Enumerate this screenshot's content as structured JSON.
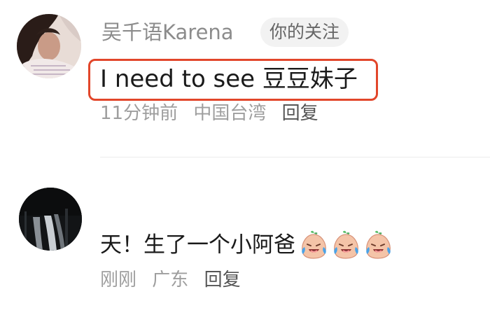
{
  "comments": [
    {
      "username": "吴千语Karena",
      "badge": "你的关注",
      "text": "I need to see 豆豆妹子",
      "time": "11分钟前",
      "location": "中国台湾",
      "reply_label": "回复",
      "highlight_color": "#e2462a"
    },
    {
      "text": "天！生了一个小阿爸",
      "emojis": [
        "crying-laugh-emoji",
        "crying-laugh-emoji",
        "crying-laugh-emoji"
      ],
      "time": "刚刚",
      "location": "广东",
      "reply_label": "回复"
    }
  ],
  "colors": {
    "username": "#8c8c8c",
    "meta": "#9e9e9e",
    "reply": "#555555",
    "text": "#1a1a1a",
    "highlight": "#e2462a"
  }
}
